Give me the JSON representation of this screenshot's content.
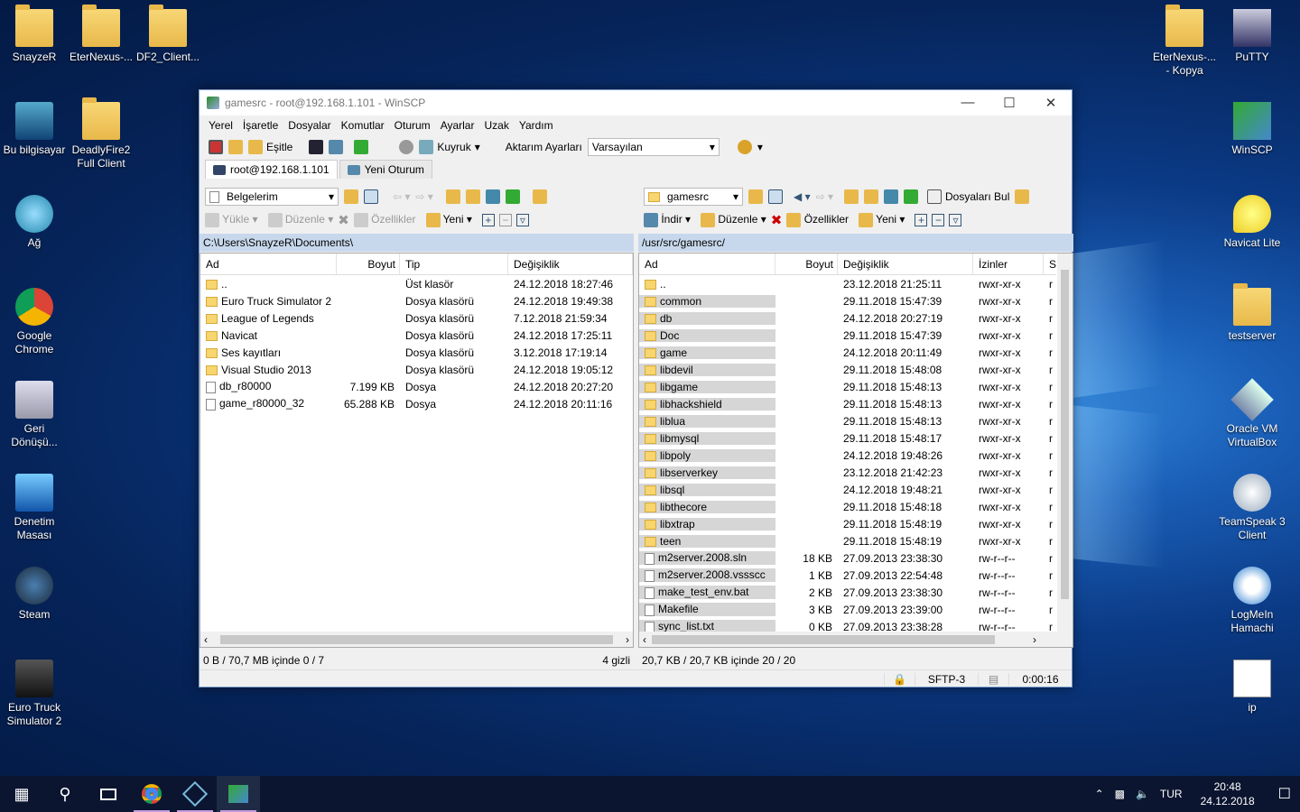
{
  "desktop": {
    "left_icons": [
      "SnayzeR",
      "EterNexus-...",
      "DF2_Client...",
      "Bu bilgisayar",
      "DeadlyFire2 Full Client",
      "Ağ",
      "Google Chrome",
      "Geri Dönüşü...",
      "Denetim Masası",
      "Steam",
      "Euro Truck Simulator 2"
    ],
    "right_icons": [
      "EterNexus-... - Kopya",
      "PuTTY",
      "WinSCP",
      "Navicat Lite",
      "testserver",
      "Oracle VM VirtualBox",
      "TeamSpeak 3 Client",
      "LogMeIn Hamachi",
      "ip"
    ]
  },
  "window": {
    "title": "gamesrc - root@192.168.1.101 - WinSCP",
    "menu": [
      "Yerel",
      "İşaretle",
      "Dosyalar",
      "Komutlar",
      "Oturum",
      "Ayarlar",
      "Uzak",
      "Yardım"
    ],
    "toolbar": {
      "sync": "Eşitle",
      "queue": "Kuyruk",
      "transfer_label": "Aktarım Ayarları",
      "transfer_value": "Varsayılan"
    },
    "tabs": {
      "session": "root@192.168.1.101",
      "new": "Yeni Oturum"
    },
    "left": {
      "dir": "Belgelerim",
      "actions": {
        "upload": "Yükle",
        "edit": "Düzenle",
        "props": "Özellikler",
        "new": "Yeni"
      },
      "path": "C:\\Users\\SnayzeR\\Documents\\",
      "headers": [
        "Ad",
        "Boyut",
        "Tip",
        "Değişiklik"
      ],
      "rows": [
        [
          "..",
          "",
          "Üst klasör",
          "24.12.2018  18:27:46",
          "dir"
        ],
        [
          "Euro Truck Simulator 2",
          "",
          "Dosya klasörü",
          "24.12.2018  19:49:38",
          "dir"
        ],
        [
          "League of Legends",
          "",
          "Dosya klasörü",
          "7.12.2018  21:59:34",
          "dir"
        ],
        [
          "Navicat",
          "",
          "Dosya klasörü",
          "24.12.2018  17:25:11",
          "dir"
        ],
        [
          "Ses kayıtları",
          "",
          "Dosya klasörü",
          "3.12.2018  17:19:14",
          "dir"
        ],
        [
          "Visual Studio 2013",
          "",
          "Dosya klasörü",
          "24.12.2018  19:05:12",
          "dir"
        ],
        [
          "db_r80000",
          "7.199 KB",
          "Dosya",
          "24.12.2018  20:27:20",
          "file"
        ],
        [
          "game_r80000_32",
          "65.288 KB",
          "Dosya",
          "24.12.2018  20:11:16",
          "file"
        ]
      ],
      "status_left": "0 B / 70,7 MB içinde 0 / 7",
      "status_right": "4 gizli"
    },
    "right": {
      "dir": "gamesrc",
      "find": "Dosyaları Bul",
      "actions": {
        "download": "İndir",
        "edit": "Düzenle",
        "props": "Özellikler",
        "new": "Yeni"
      },
      "path": "/usr/src/gamesrc/",
      "headers": [
        "Ad",
        "Boyut",
        "Değişiklik",
        "İzinler",
        "S"
      ],
      "rows": [
        [
          "..",
          "",
          "23.12.2018 21:25:11",
          "rwxr-xr-x",
          "dir"
        ],
        [
          "common",
          "",
          "29.11.2018 15:47:39",
          "rwxr-xr-x",
          "dir"
        ],
        [
          "db",
          "",
          "24.12.2018 20:27:19",
          "rwxr-xr-x",
          "dir"
        ],
        [
          "Doc",
          "",
          "29.11.2018 15:47:39",
          "rwxr-xr-x",
          "dir"
        ],
        [
          "game",
          "",
          "24.12.2018 20:11:49",
          "rwxr-xr-x",
          "dir"
        ],
        [
          "libdevil",
          "",
          "29.11.2018 15:48:08",
          "rwxr-xr-x",
          "dir"
        ],
        [
          "libgame",
          "",
          "29.11.2018 15:48:13",
          "rwxr-xr-x",
          "dir"
        ],
        [
          "libhackshield",
          "",
          "29.11.2018 15:48:13",
          "rwxr-xr-x",
          "dir"
        ],
        [
          "liblua",
          "",
          "29.11.2018 15:48:13",
          "rwxr-xr-x",
          "dir"
        ],
        [
          "libmysql",
          "",
          "29.11.2018 15:48:17",
          "rwxr-xr-x",
          "dir"
        ],
        [
          "libpoly",
          "",
          "24.12.2018 19:48:26",
          "rwxr-xr-x",
          "dir"
        ],
        [
          "libserverkey",
          "",
          "23.12.2018 21:42:23",
          "rwxr-xr-x",
          "dir"
        ],
        [
          "libsql",
          "",
          "24.12.2018 19:48:21",
          "rwxr-xr-x",
          "dir"
        ],
        [
          "libthecore",
          "",
          "29.11.2018 15:48:18",
          "rwxr-xr-x",
          "dir"
        ],
        [
          "libxtrap",
          "",
          "29.11.2018 15:48:19",
          "rwxr-xr-x",
          "dir"
        ],
        [
          "teen",
          "",
          "29.11.2018 15:48:19",
          "rwxr-xr-x",
          "dir"
        ],
        [
          "m2server.2008.sln",
          "18 KB",
          "27.09.2013 23:38:30",
          "rw-r--r--",
          "file"
        ],
        [
          "m2server.2008.vssscc",
          "1 KB",
          "27.09.2013 22:54:48",
          "rw-r--r--",
          "file"
        ],
        [
          "make_test_env.bat",
          "2 KB",
          "27.09.2013 23:38:30",
          "rw-r--r--",
          "file"
        ],
        [
          "Makefile",
          "3 KB",
          "27.09.2013 23:39:00",
          "rw-r--r--",
          "file"
        ],
        [
          "sync_list.txt",
          "0 KB",
          "27.09.2013 23:38:28",
          "rw-r--r--",
          "file"
        ]
      ],
      "status": "20,7 KB / 20,7 KB içinde 20 / 20"
    },
    "bottom": {
      "protocol": "SFTP-3",
      "time": "0:00:16"
    }
  },
  "taskbar": {
    "lang": "TUR",
    "clock_time": "20:48",
    "clock_date": "24.12.2018"
  }
}
